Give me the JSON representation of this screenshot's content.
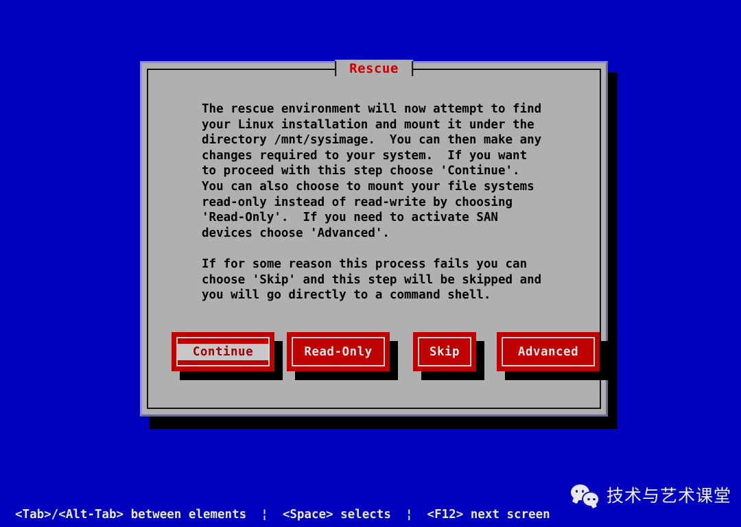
{
  "screen": {
    "background_color": "#0000bf"
  },
  "dialog": {
    "title": "Rescue",
    "title_color": "#cc0000",
    "background_color": "#b0b0b0",
    "paragraphs": [
      "The rescue environment will now attempt to find\nyour Linux installation and mount it under the\ndirectory /mnt/sysimage.  You can then make any\nchanges required to your system.  If you want\nto proceed with this step choose 'Continue'.\nYou can also choose to mount your file systems\nread-only instead of read-write by choosing\n'Read-Only'.  If you need to activate SAN\ndevices choose 'Advanced'.",
      "If for some reason this process fails you can\nchoose 'Skip' and this step will be skipped and\nyou will go directly to a command shell."
    ],
    "buttons": [
      {
        "label": "Continue",
        "focused": true,
        "color": "#c00000"
      },
      {
        "label": "Read-Only",
        "focused": false,
        "color": "#c00000"
      },
      {
        "label": "Skip",
        "focused": false,
        "color": "#c00000"
      },
      {
        "label": "Advanced",
        "focused": false,
        "color": "#c00000"
      }
    ]
  },
  "status_bar": {
    "text": "<Tab>/<Alt-Tab> between elements  ¦  <Space> selects  ¦  <F12> next screen",
    "color": "#e8e8e8"
  },
  "watermark": {
    "icon": "wechat-icon",
    "text": "技术与艺术课堂"
  }
}
